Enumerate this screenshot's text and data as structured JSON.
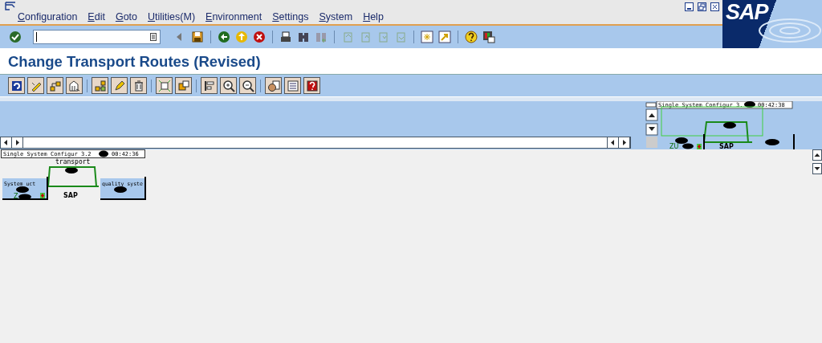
{
  "window": {
    "title": "Change Transport Routes (Revised)"
  },
  "menu": [
    {
      "label": "Configuration"
    },
    {
      "label": "Edit"
    },
    {
      "label": "Goto"
    },
    {
      "label": "Utilities(M)"
    },
    {
      "label": "Environment"
    },
    {
      "label": "Settings"
    },
    {
      "label": "System"
    },
    {
      "label": "Help"
    }
  ],
  "logo": {
    "text": "SAP"
  },
  "navigator": {
    "header": "Single System Configur 3.",
    "time": "00:42:38",
    "domain_label": "SAP",
    "client_label": "ZU"
  },
  "diagram": {
    "header": "Single System Configur 3.2",
    "time": "00:42:36",
    "transport_layer": "transport",
    "domain_label": "SAP",
    "systems": [
      {
        "label": "System uct",
        "client_label": "Z"
      },
      {
        "label": "quality syste"
      }
    ]
  }
}
